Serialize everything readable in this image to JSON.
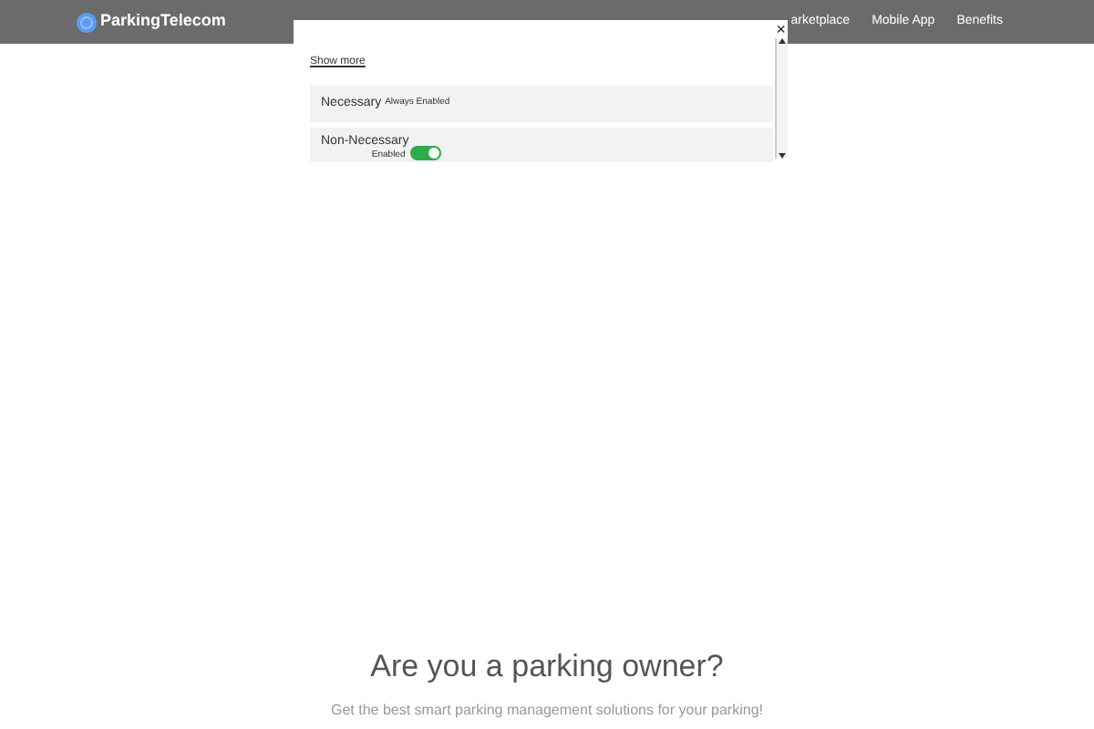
{
  "header": {
    "logo": "ParkingTelecom",
    "nav": [
      {
        "label": "arketplace"
      },
      {
        "label": "Mobile App"
      },
      {
        "label": "Benefits"
      }
    ]
  },
  "consent_dialog": {
    "close": "×",
    "show_more": "Show more",
    "categories": [
      {
        "name": "Necessary",
        "status": "Always Enabled",
        "kind": "fixed"
      },
      {
        "name": "Non-Necessary",
        "status": "Enabled",
        "kind": "toggle",
        "on": true
      }
    ]
  },
  "hero": {
    "title": "Are you a parking owner?",
    "subtitle": "Get the best smart parking management solutions for your parking!"
  }
}
